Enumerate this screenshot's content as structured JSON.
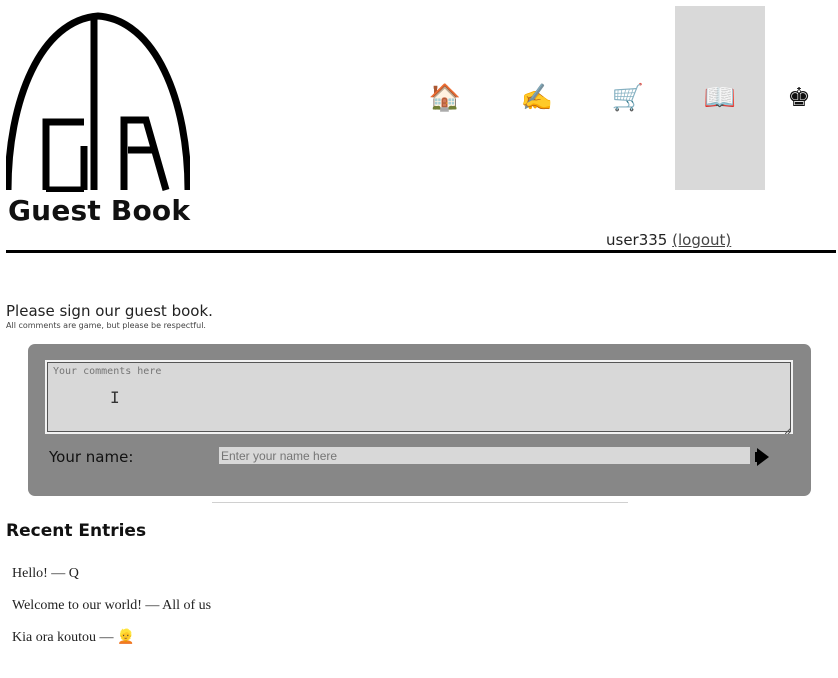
{
  "header": {
    "site_title": "Guest Book",
    "logo_letters": "GA",
    "nav": [
      {
        "icon": "house-icon",
        "glyph": "🏠",
        "active": false
      },
      {
        "icon": "writing-hand-icon",
        "glyph": "✍️",
        "active": false
      },
      {
        "icon": "shopping-cart-icon",
        "glyph": "🛒",
        "active": false
      },
      {
        "icon": "open-book-icon",
        "glyph": "📖",
        "active": true
      },
      {
        "icon": "chess-king-icon",
        "glyph": "♚",
        "active": false
      }
    ],
    "username": "user335",
    "logout_label": "(logout)"
  },
  "intro": {
    "heading": "Please sign our guest book.",
    "subtext": "All comments are game, but please be respectful."
  },
  "form": {
    "comment_placeholder": "Your comments here",
    "name_label": "Your name:",
    "name_placeholder": "Enter your name here"
  },
  "recent": {
    "title": "Recent Entries",
    "entries": [
      {
        "text": "Hello! — Q"
      },
      {
        "text": "Welcome to our world! — All of us"
      },
      {
        "text": "Kia ora koutou — 👱"
      }
    ]
  },
  "colors": {
    "panel": "#878787",
    "active_nav": "#d9d9d9",
    "input_bg": "#d8d8d8"
  }
}
